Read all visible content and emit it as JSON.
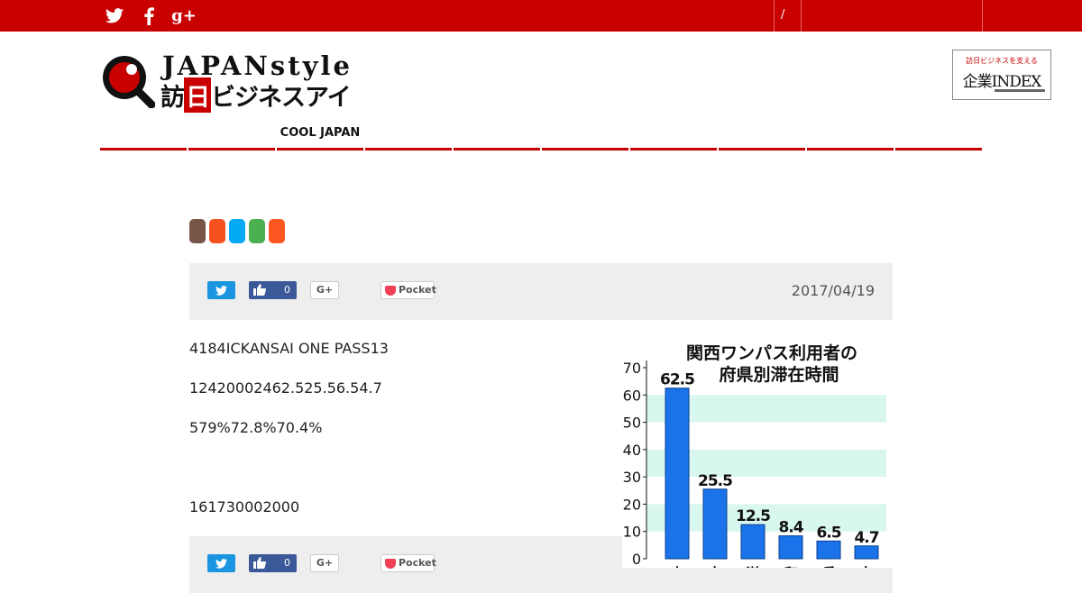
{
  "topbar": {
    "icons": [
      "twitter-icon",
      "facebook-icon",
      "google-plus-icon"
    ],
    "gplus_text": "g+",
    "separator": "/"
  },
  "header": {
    "logo_en": "JAPANstyle",
    "logo_jp_1": "訪",
    "logo_jp_box": "日",
    "logo_jp_2": "ビジネスアイ",
    "index_small": "訪日ビジネスを支える",
    "index_big": "企業INDEX"
  },
  "nav": {
    "items": [
      "",
      "",
      "COOL JAPAN",
      "",
      "",
      "",
      "",
      "",
      "",
      ""
    ]
  },
  "tags": {
    "colors": [
      "#795548",
      "#f4511e",
      "#03a9f4",
      "#4caf50",
      "#ff5722"
    ]
  },
  "share": {
    "fb_count": "0",
    "gplus_label": "G+",
    "pocket_label": "Pocket",
    "date": "2017/04/19"
  },
  "article": {
    "paragraphs": [
      "4184ICKANSAI ONE PASS13",
      "12420002462.525.56.54.7",
      "579%72.8%70.4%",
      "161730002000"
    ]
  },
  "colors": {
    "brand_red": "#c80000",
    "chart_bar": "#1a73e8",
    "chart_band": "#d8f7ef"
  },
  "chart_data": {
    "type": "bar",
    "title": "関西ワンパス利用者の府県別滞在時間",
    "title_line1": "関西ワンパス利用者の",
    "title_line2": "府県別滞在時間",
    "values": [
      62.5,
      25.5,
      12.5,
      8.4,
      6.5,
      4.7
    ],
    "value_labels": [
      "62.5",
      "25.5",
      "12.5",
      "8.4",
      "6.5",
      "4.7"
    ],
    "categories": [
      "大",
      "京",
      "滋",
      "和",
      "兵",
      "奈"
    ],
    "yticks": [
      "0",
      "10",
      "20",
      "30",
      "40",
      "50",
      "60",
      "70"
    ],
    "ylim": [
      0,
      70
    ]
  }
}
